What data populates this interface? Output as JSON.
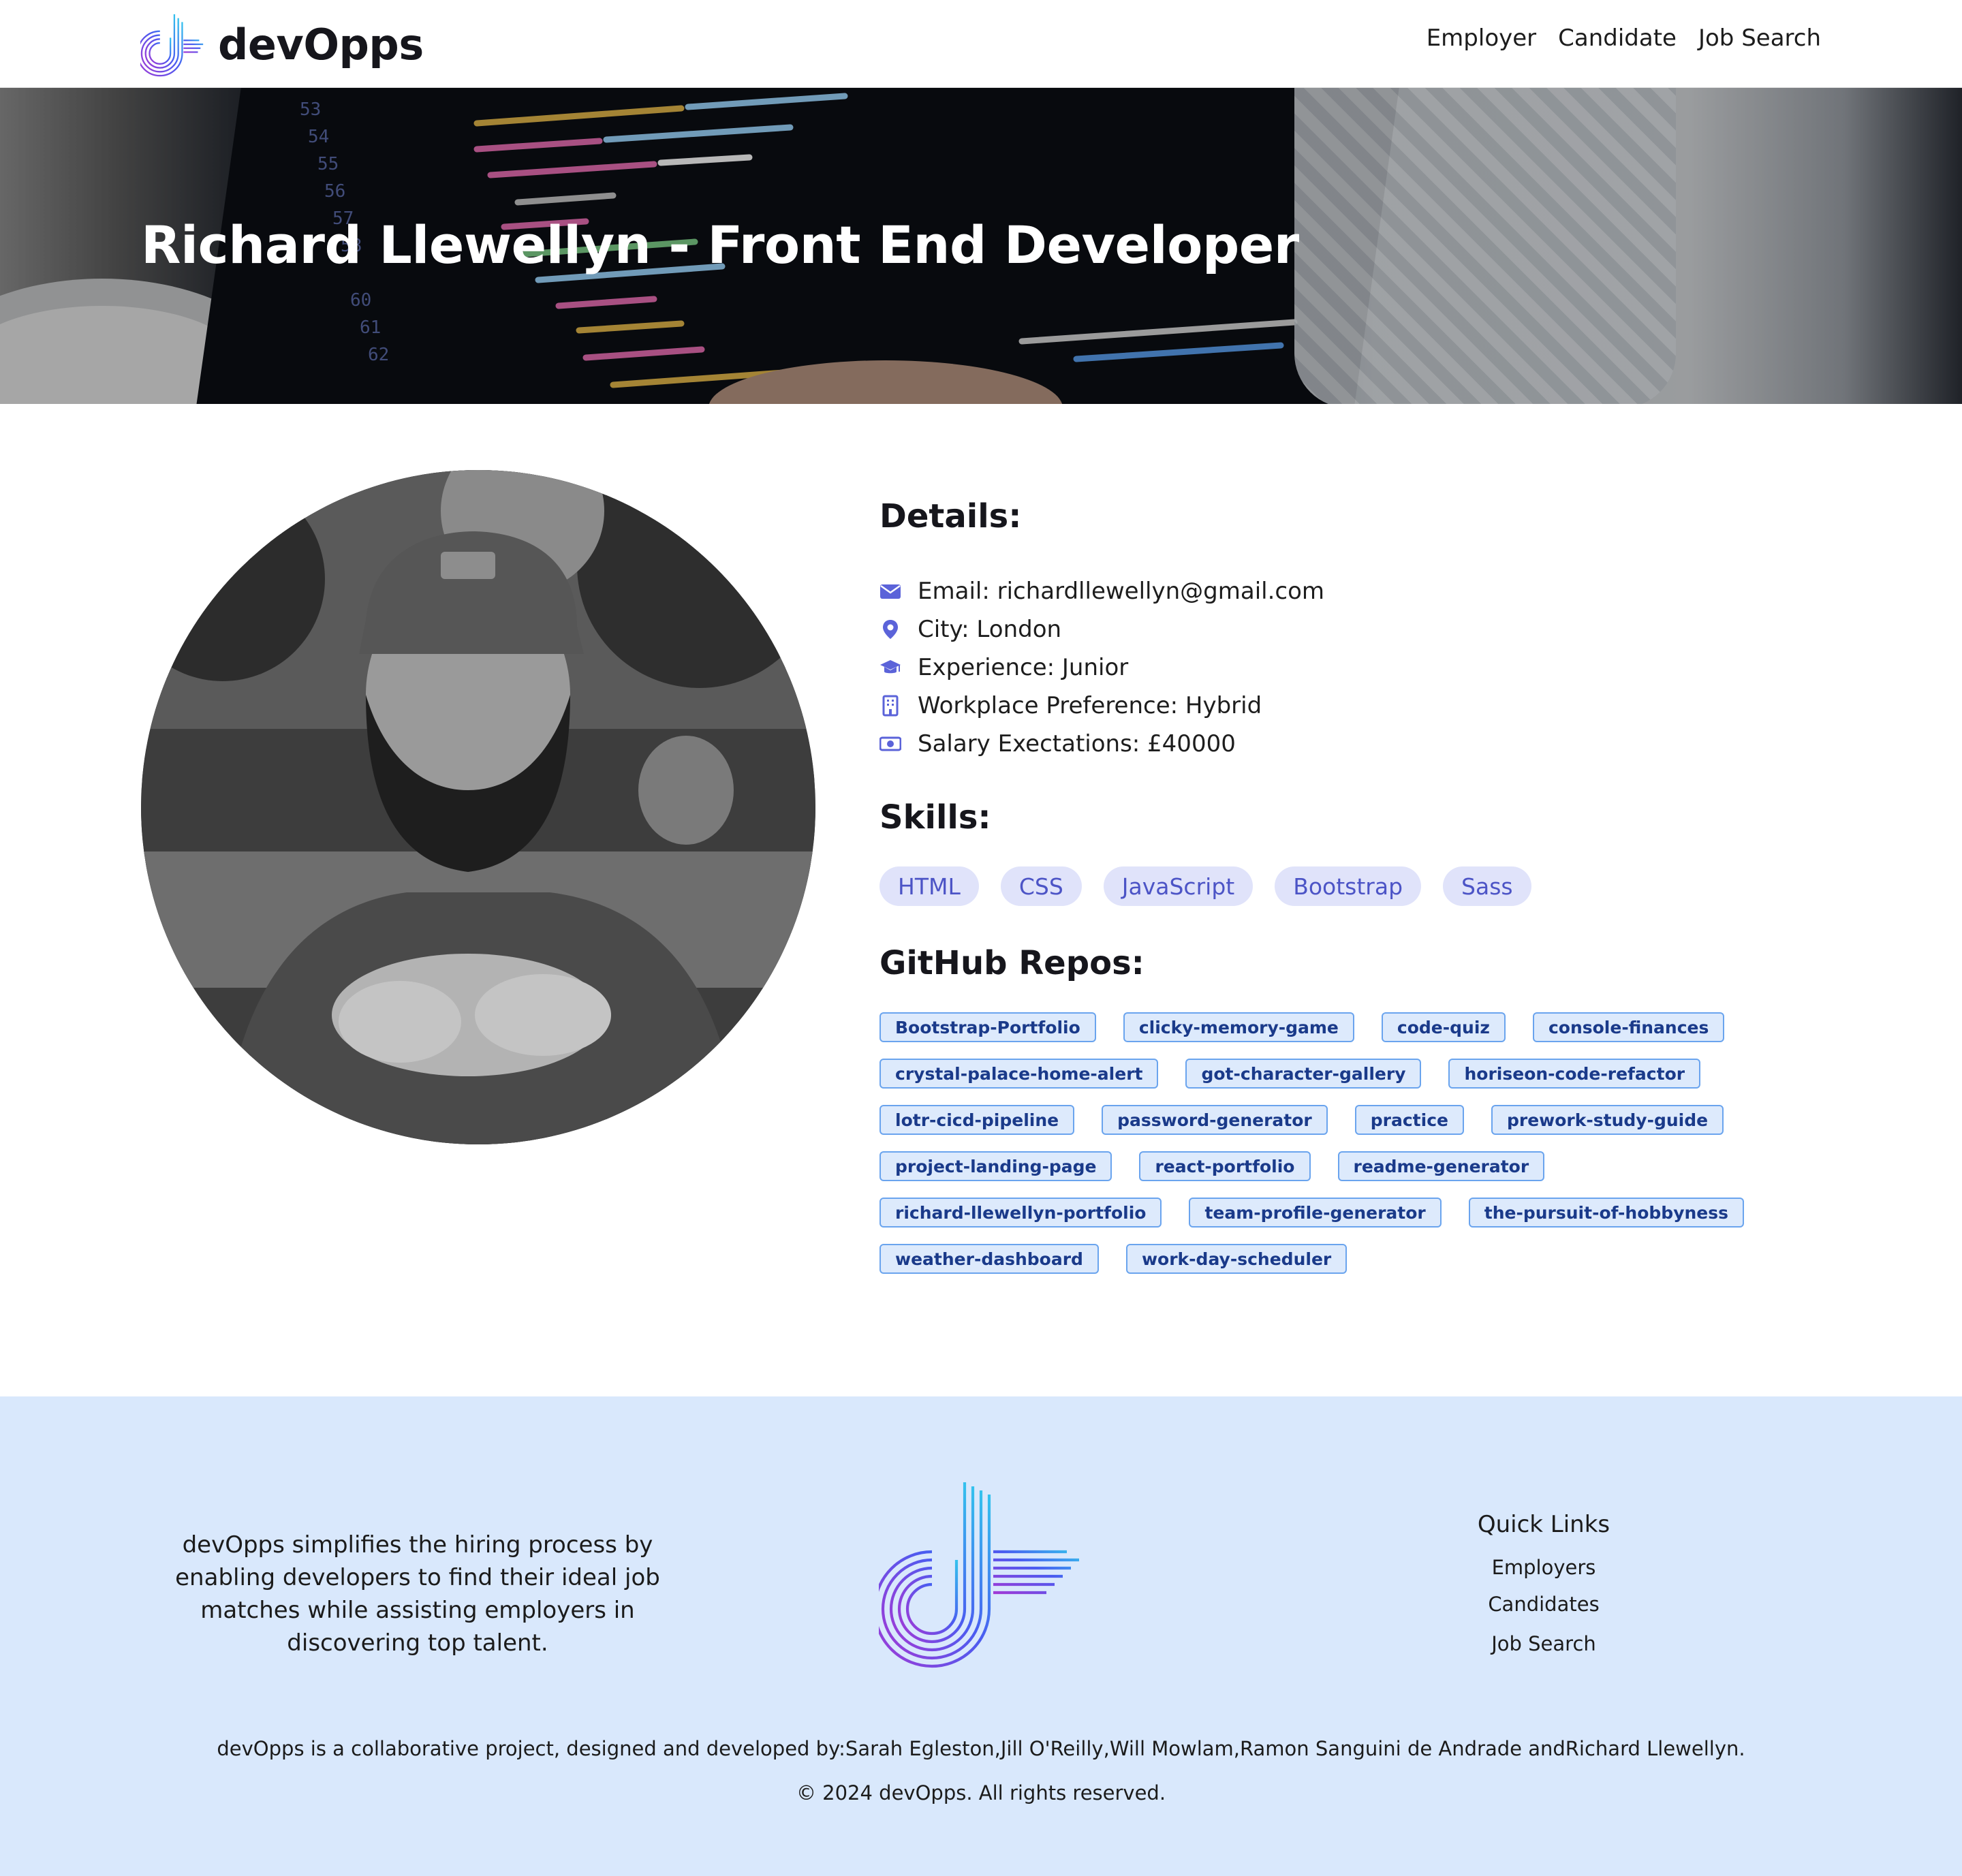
{
  "brand": {
    "name": "devOpps"
  },
  "nav": {
    "items": [
      "Employer",
      "Candidate",
      "Job Search"
    ]
  },
  "hero": {
    "title": "Richard Llewellyn - Front End Developer"
  },
  "details": {
    "title": "Details:",
    "items": [
      {
        "icon": "envelope-icon",
        "text": "Email: richardllewellyn@gmail.com"
      },
      {
        "icon": "map-pin-icon",
        "text": "City: London"
      },
      {
        "icon": "graduation-cap-icon",
        "text": "Experience: Junior"
      },
      {
        "icon": "building-icon",
        "text": "Workplace Preference: Hybrid"
      },
      {
        "icon": "money-bill-icon",
        "text": "Salary Exectations: £40000"
      }
    ]
  },
  "skills": {
    "title": "Skills:",
    "items": [
      "HTML",
      "CSS",
      "JavaScript",
      "Bootstrap",
      "Sass"
    ]
  },
  "repos": {
    "title": "GitHub Repos:",
    "items": [
      "Bootstrap-Portfolio",
      "clicky-memory-game",
      "code-quiz",
      "console-finances",
      "crystal-palace-home-alert",
      "got-character-gallery",
      "horiseon-code-refactor",
      "lotr-cicd-pipeline",
      "password-generator",
      "practice",
      "prework-study-guide",
      "project-landing-page",
      "react-portfolio",
      "readme-generator",
      "richard-llewellyn-portfolio",
      "team-profile-generator",
      "the-pursuit-of-hobbyness",
      "weather-dashboard",
      "work-day-scheduler"
    ]
  },
  "footer": {
    "about": "devOpps simplifies the hiring process by enabling developers to find their ideal job matches while assisting employers in discovering top talent.",
    "quick_links_title": "Quick Links",
    "quick_links": [
      "Employers",
      "Candidates",
      "Job Search"
    ],
    "credits": "devOpps is a collaborative project, designed and developed by:Sarah Egleston,Jill O'Reilly,Will Mowlam,Ramon Sanguini de Andrade andRichard Llewellyn.",
    "copyright": "© 2024 devOpps. All rights reserved."
  },
  "colors": {
    "accent": "#5b63d9",
    "skill_bg": "#e0e3fa",
    "repo_bg": "#ddeafc",
    "repo_border": "#6aa4ee",
    "footer_bg": "#d9e8fc"
  }
}
